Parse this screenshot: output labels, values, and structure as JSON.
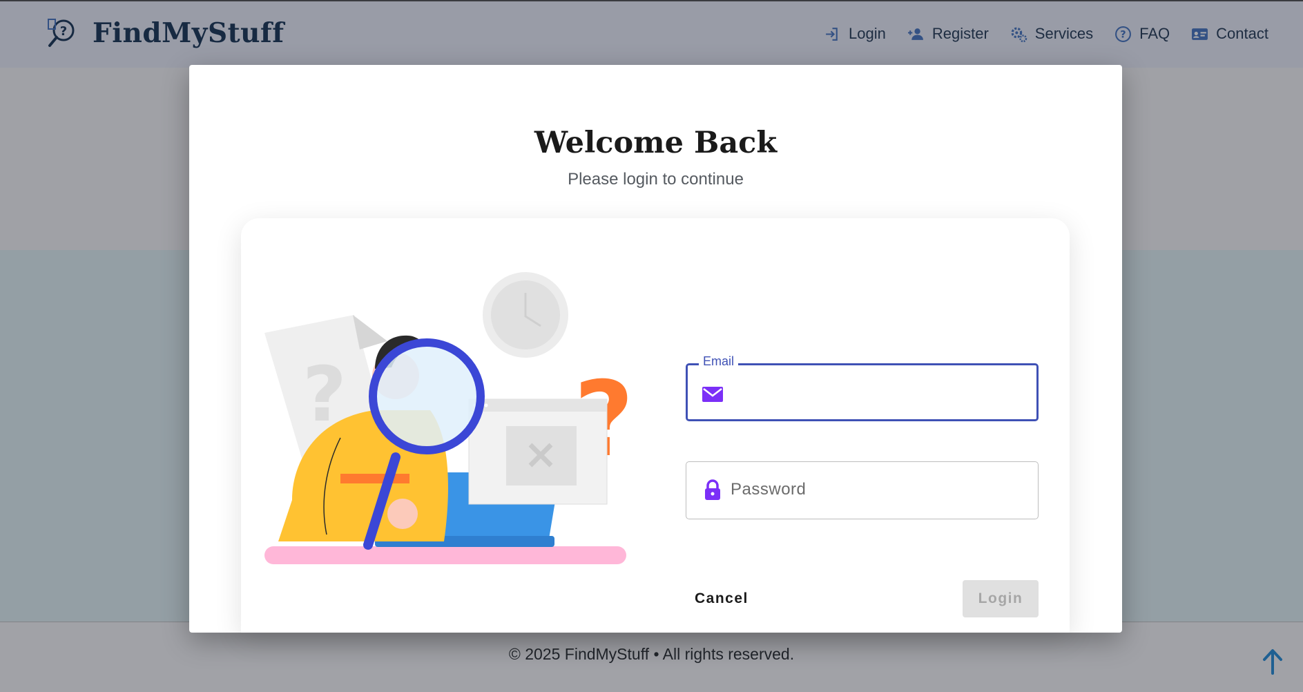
{
  "navbar": {
    "brand": "FindMyStuff",
    "items": [
      {
        "label": "Login",
        "icon": "login-icon"
      },
      {
        "label": "Register",
        "icon": "user-plus-icon"
      },
      {
        "label": "Services",
        "icon": "gears-icon"
      },
      {
        "label": "FAQ",
        "icon": "question-circle-icon"
      },
      {
        "label": "Contact",
        "icon": "contact-card-icon"
      }
    ]
  },
  "modal": {
    "title": "Welcome Back",
    "subtitle": "Please login to continue",
    "email": {
      "label": "Email",
      "value": "",
      "icon": "envelope-icon"
    },
    "password": {
      "placeholder": "Password",
      "value": "",
      "icon": "lock-icon"
    },
    "cancel_label": "Cancel",
    "login_label": "Login"
  },
  "footer": {
    "text": "© 2025 FindMyStuff • All rights reserved."
  },
  "colors": {
    "accent": "#3f51b5",
    "icon_purple": "#7b2ff7",
    "brand_text": "#1f3a5a"
  }
}
